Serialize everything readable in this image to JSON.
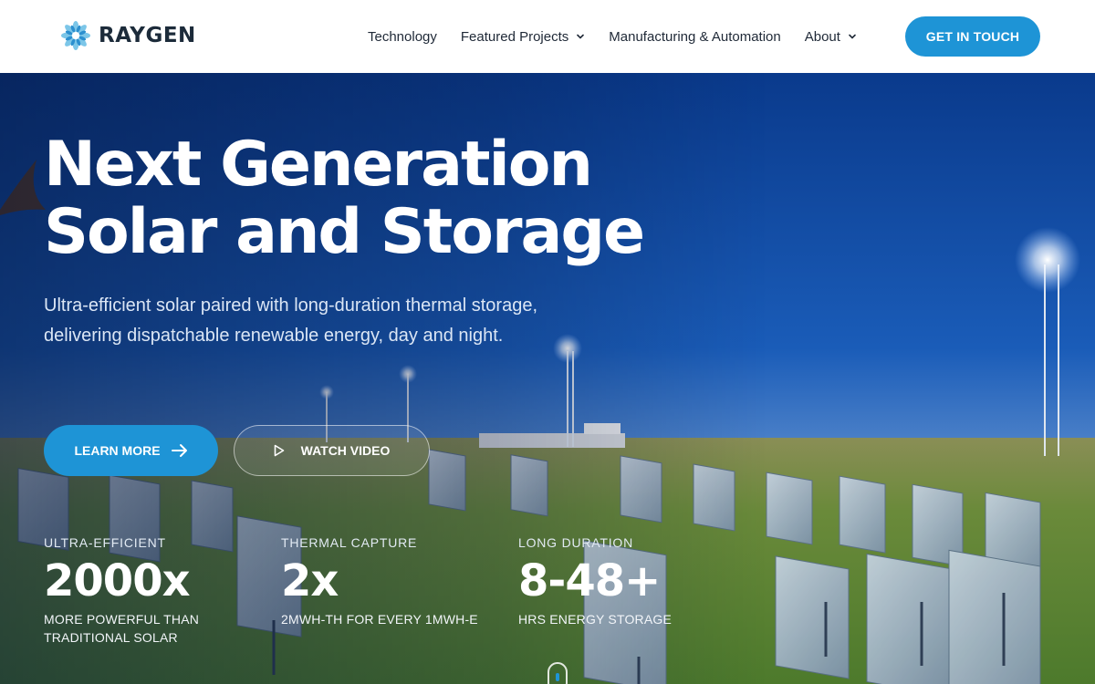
{
  "brand": {
    "name": "RAYGEN",
    "accent": "#1e94d6",
    "dark": "#1c2b3a"
  },
  "nav": {
    "items": [
      {
        "label": "Technology",
        "has_dropdown": false
      },
      {
        "label": "Featured Projects",
        "has_dropdown": true
      },
      {
        "label": "Manufacturing & Automation",
        "has_dropdown": false
      },
      {
        "label": "About",
        "has_dropdown": true
      }
    ],
    "cta_label": "GET IN TOUCH"
  },
  "hero": {
    "title_line1": "Next Generation",
    "title_line2": "Solar and Storage",
    "subtitle": "Ultra-efficient solar paired with long-duration thermal storage, delivering dispatchable renewable energy, day and night.",
    "learn_more_label": "LEARN MORE",
    "watch_video_label": "WATCH VIDEO",
    "icons": {
      "learn_more": "arrow-right-icon",
      "watch_video": "play-icon"
    }
  },
  "stats": [
    {
      "label": "ULTRA-EFFICIENT",
      "value": "2000x",
      "desc_line1": "MORE POWERFUL THAN",
      "desc_line2": "TRADITIONAL SOLAR"
    },
    {
      "label": "THERMAL CAPTURE",
      "value": "2x",
      "desc_line1": "2MWH-TH FOR EVERY 1MWH-E",
      "desc_line2": ""
    },
    {
      "label": "LONG DURATION",
      "value": "8-48+",
      "desc_line1": "HRS ENERGY STORAGE",
      "desc_line2": ""
    }
  ]
}
